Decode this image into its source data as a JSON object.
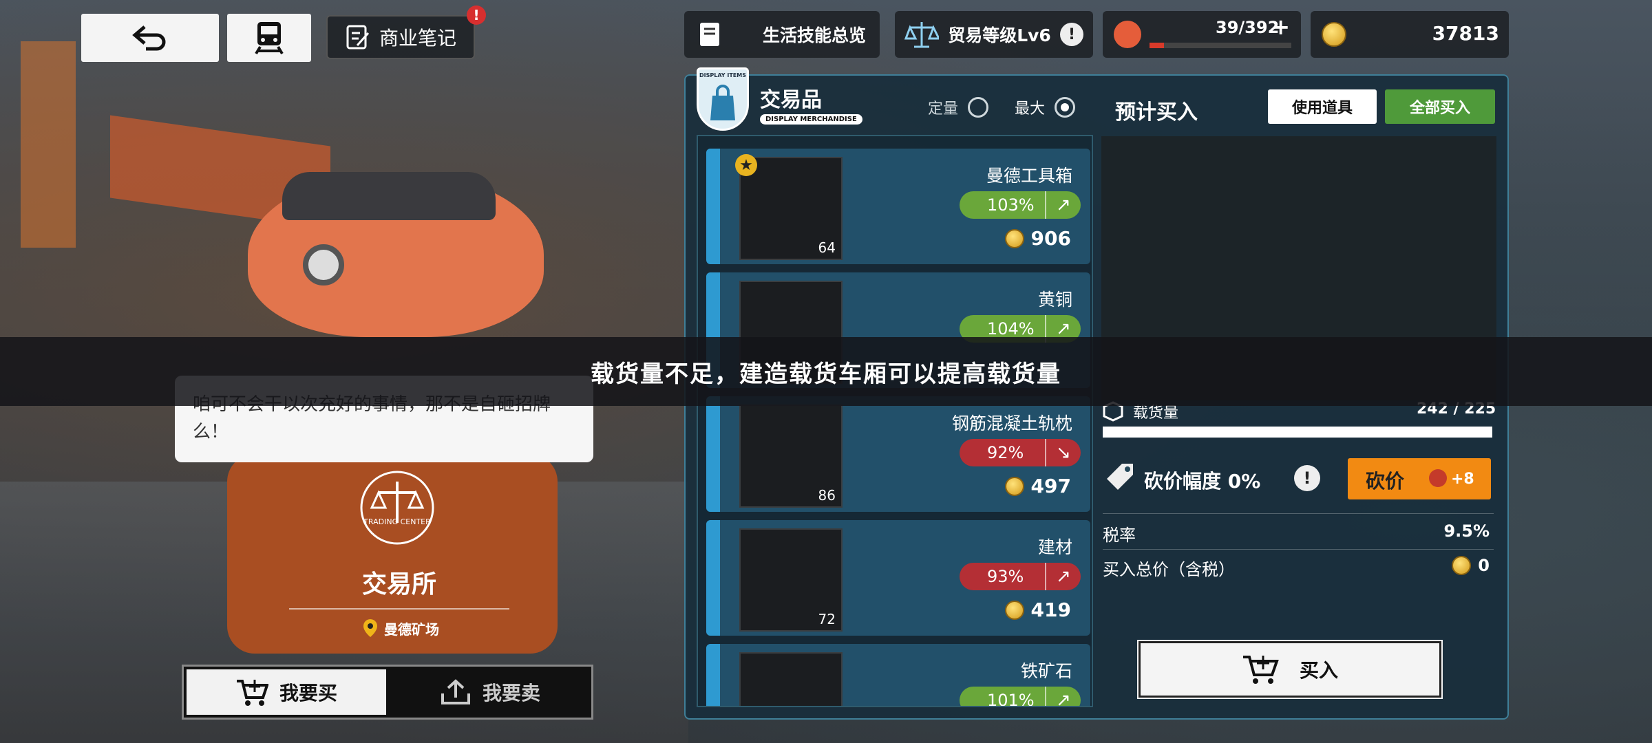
{
  "top": {
    "notes_label": "商业笔记",
    "notes_badge": "!",
    "skills_label": "生活技能总览",
    "trade_level": "贸易等级Lv6",
    "trade_badge": "!",
    "stamina": "39/392",
    "stamina_plus": "+",
    "coins": "37813"
  },
  "npc": {
    "speech": "咱可不会干以次充好的事情，那不是自砸招牌么！",
    "place_title": "交易所",
    "emblem_text": "TRADING CENTER",
    "location": "曼德矿场"
  },
  "mode": {
    "buy": "我要买",
    "sell": "我要卖"
  },
  "panel": {
    "badge_top": "DISPLAY ITEMS",
    "title": "交易品",
    "subtitle": "DISPLAY MERCHANDISE",
    "opt_fixed": "定量",
    "opt_max": "最大",
    "expected": "预计买入",
    "use_item": "使用道具",
    "buy_all": "全部买入"
  },
  "items": [
    {
      "name": "曼德工具箱",
      "pct": "103%",
      "trend": "up",
      "color": "green",
      "price": "906",
      "qty": "64",
      "starred": true
    },
    {
      "name": "黄铜",
      "pct": "104%",
      "trend": "up",
      "color": "green",
      "price": "",
      "qty": "",
      "starred": false
    },
    {
      "name": "钢筋混凝土轨枕",
      "pct": "92%",
      "trend": "down",
      "color": "red",
      "price": "497",
      "qty": "86",
      "starred": false
    },
    {
      "name": "建材",
      "pct": "93%",
      "trend": "up",
      "color": "red",
      "price": "419",
      "qty": "72",
      "starred": false
    },
    {
      "name": "铁矿石",
      "pct": "101%",
      "trend": "up",
      "color": "green",
      "price": "",
      "qty": "",
      "starred": false
    }
  ],
  "cargo": {
    "label": "载货量",
    "value": "242",
    "capacity": "225",
    "fill_ratio": 1.0
  },
  "bargain": {
    "label": "砍价幅度 0%",
    "badge": "!",
    "button": "砍价",
    "cost": "+8"
  },
  "tax": {
    "label": "税率",
    "value": "9.5%"
  },
  "total": {
    "label": "买入总价（含税）",
    "value": "0"
  },
  "buy_button": "买入",
  "toast": "载货量不足，建造载货车厢可以提高载货量",
  "colors": {
    "accent_green": "#4f9a3a",
    "alert_red": "#d72f2f",
    "bargain_orange": "#f28a12"
  }
}
